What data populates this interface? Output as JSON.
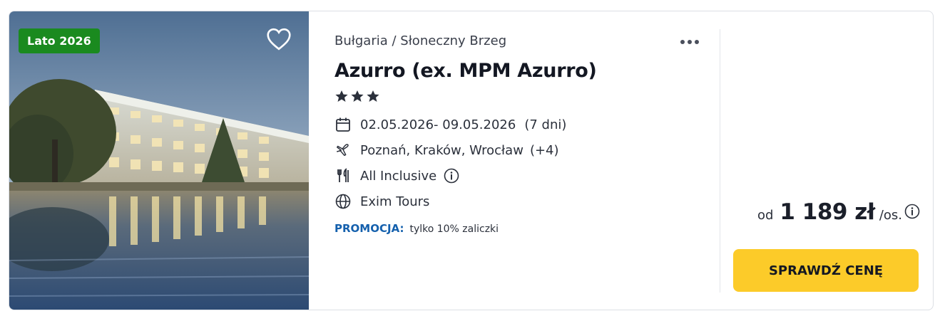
{
  "card": {
    "badge": "Lato 2026",
    "location": "Bułgaria / Słoneczny Brzeg",
    "hotel_name": "Azurro (ex. MPM Azurro)",
    "stars": 3,
    "dates": "02.05.2026- 09.05.2026",
    "duration": "(7 dni)",
    "airports": "Poznań, Kraków, Wrocław",
    "airports_more": "(+4)",
    "board": "All Inclusive",
    "operator": "Exim Tours",
    "promo_label": "PROMOCJA:",
    "promo_text": "tylko 10% zaliczki",
    "price_prefix": "od",
    "price": "1 189 zł",
    "price_suffix": "/os.",
    "cta_label": "SPRAWDŹ CENĘ"
  },
  "colors": {
    "badge": "#1a8a1f",
    "promo": "#1460ad",
    "cta": "#fccb29"
  },
  "icons": [
    "heart-icon",
    "more-dots-icon",
    "star-icon",
    "calendar-icon",
    "plane-icon",
    "cutlery-icon",
    "info-icon",
    "globe-icon"
  ]
}
